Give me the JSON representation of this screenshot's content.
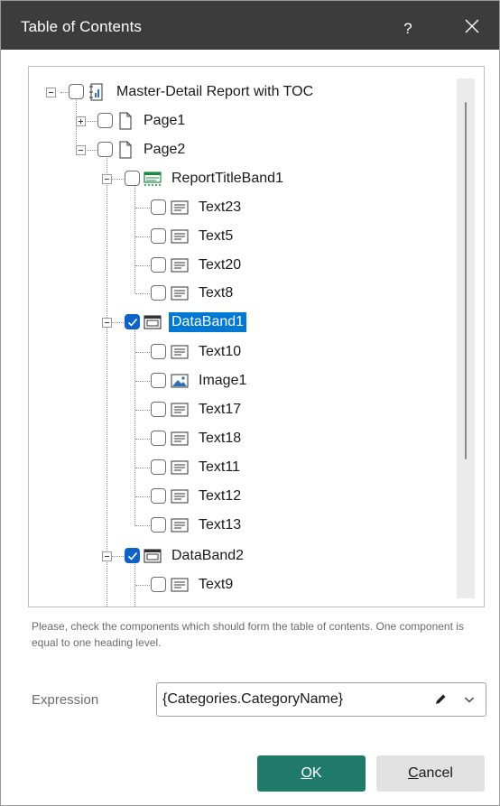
{
  "window": {
    "title": "Table of Contents",
    "help_label": "?"
  },
  "tree": {
    "root": {
      "label": "Master-Detail Report with TOC",
      "checked": false,
      "expanded": true
    },
    "nodes": [
      {
        "label": "Page1",
        "checked": false,
        "expanded": false
      },
      {
        "label": "Page2",
        "checked": false,
        "expanded": true
      },
      {
        "label": "ReportTitleBand1",
        "checked": false,
        "expanded": true
      },
      {
        "label": "Text23",
        "checked": false
      },
      {
        "label": "Text5",
        "checked": false
      },
      {
        "label": "Text20",
        "checked": false
      },
      {
        "label": "Text8",
        "checked": false
      },
      {
        "label": "DataBand1",
        "checked": true,
        "expanded": true,
        "selected": true
      },
      {
        "label": "Text10",
        "checked": false
      },
      {
        "label": "Image1",
        "checked": false
      },
      {
        "label": "Text17",
        "checked": false
      },
      {
        "label": "Text18",
        "checked": false
      },
      {
        "label": "Text11",
        "checked": false
      },
      {
        "label": "Text12",
        "checked": false
      },
      {
        "label": "Text13",
        "checked": false
      },
      {
        "label": "DataBand2",
        "checked": true,
        "expanded": true
      },
      {
        "label": "Text9",
        "checked": false
      }
    ]
  },
  "hint": "Please, check the components which should form the table of contents. One component is equal to one heading level.",
  "expression": {
    "label": "Expression",
    "value": "{Categories.CategoryName}"
  },
  "buttons": {
    "ok_mnemonic": "O",
    "ok_rest": "K",
    "cancel_mnemonic": "C",
    "cancel_rest": "ancel"
  },
  "colors": {
    "titlebar": "#3c3c3c",
    "selection": "#0078d4",
    "checkbox_checked": "#0f62c7",
    "ok_button": "#1f7a6a"
  }
}
